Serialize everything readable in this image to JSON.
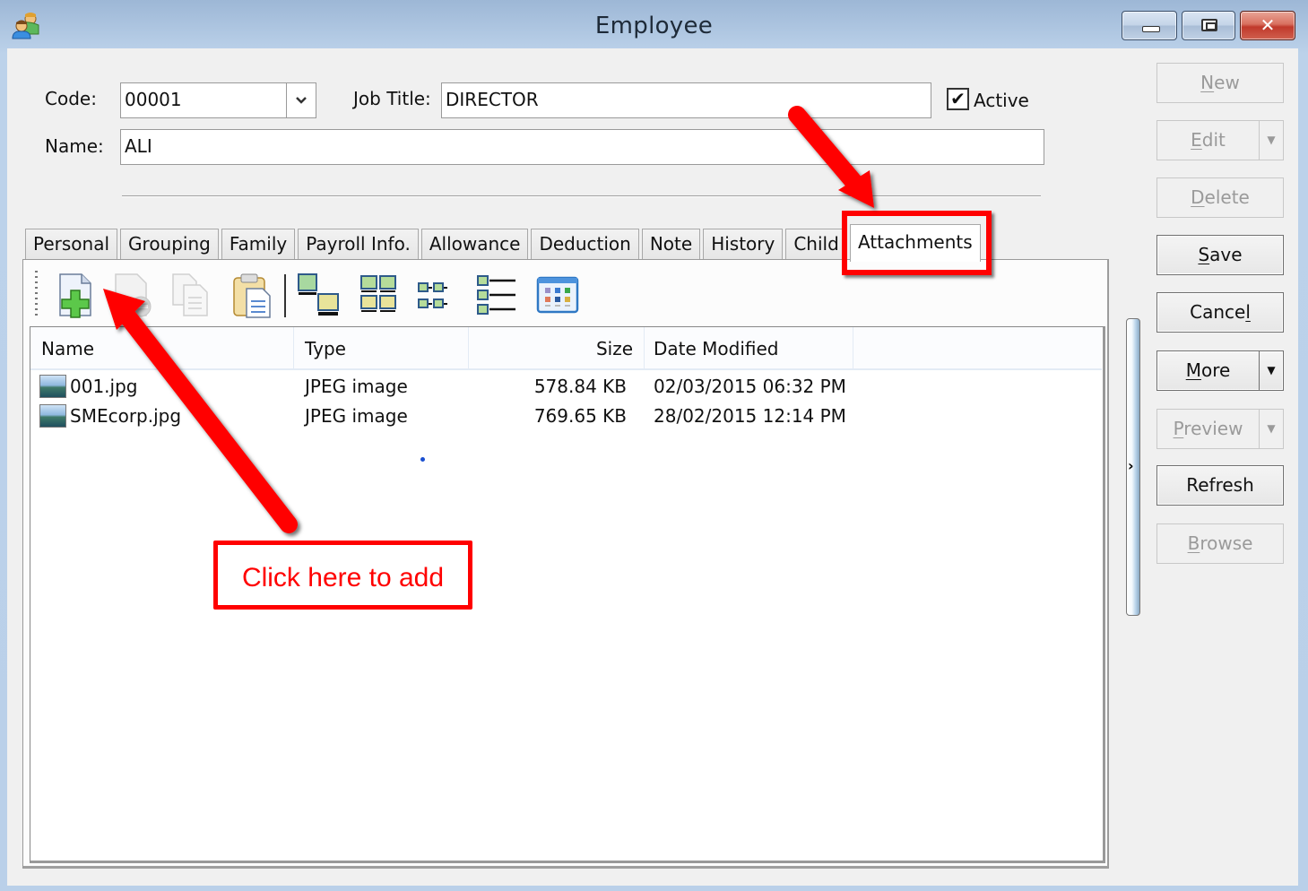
{
  "window": {
    "title": "Employee",
    "minimize_label": "",
    "close_label": "✕"
  },
  "form": {
    "code_label": "Code:",
    "code_value": "00001",
    "code_dropdown_glyph": "⌄",
    "job_title_label": "Job Title:",
    "job_title_value": "DIRECTOR",
    "active_label": "Active",
    "active_checked": true,
    "active_glyph": "✔",
    "name_label": "Name:",
    "name_value": "ALI"
  },
  "tabs": [
    {
      "label": "Personal"
    },
    {
      "label": "Grouping"
    },
    {
      "label": "Family"
    },
    {
      "label": "Payroll Info."
    },
    {
      "label": "Allowance"
    },
    {
      "label": "Deduction"
    },
    {
      "label": "Note"
    },
    {
      "label": "History"
    },
    {
      "label": "Child"
    },
    {
      "label": "Attachments",
      "active": true
    }
  ],
  "toolbar": {
    "items": [
      {
        "icon": "add-file-icon",
        "enabled": true
      },
      {
        "icon": "remove-file-icon",
        "enabled": false
      },
      {
        "icon": "copy-icon",
        "enabled": false
      },
      {
        "icon": "paste-icon",
        "enabled": true
      },
      {
        "icon": "view-large-icons-icon",
        "enabled": true
      },
      {
        "icon": "view-thumbnails-icon",
        "enabled": true
      },
      {
        "icon": "view-small-icons-icon",
        "enabled": true
      },
      {
        "icon": "view-list-icon",
        "enabled": true
      },
      {
        "icon": "view-details-icon",
        "enabled": true
      }
    ]
  },
  "attachments": {
    "columns": [
      "Name",
      "Type",
      "Size",
      "Date Modified"
    ],
    "rows": [
      {
        "name": "001.jpg",
        "type": "JPEG image",
        "size": "578.84 KB",
        "date_modified": "02/03/2015 06:32 PM"
      },
      {
        "name": "SMEcorp.jpg",
        "type": "JPEG image",
        "size": "769.65 KB",
        "date_modified": "28/02/2015 12:14 PM"
      }
    ]
  },
  "side_buttons": {
    "new": {
      "pre": "",
      "ul": "N",
      "post": "ew",
      "enabled": false
    },
    "edit": {
      "pre": "",
      "ul": "E",
      "post": "dit",
      "enabled": false
    },
    "delete": {
      "pre": "",
      "ul": "D",
      "post": "elete",
      "enabled": false
    },
    "save": {
      "pre": "",
      "ul": "S",
      "post": "ave",
      "enabled": true
    },
    "cancel": {
      "pre": "Cance",
      "ul": "l",
      "post": "",
      "enabled": true
    },
    "more": {
      "pre": "",
      "ul": "M",
      "post": "ore",
      "enabled": true
    },
    "preview": {
      "pre": "",
      "ul": "P",
      "post": "review",
      "enabled": false
    },
    "refresh": {
      "pre": "Refresh",
      "ul": "",
      "post": "",
      "enabled": true
    },
    "browse": {
      "pre": "",
      "ul": "B",
      "post": "rowse",
      "enabled": false
    },
    "dropdown_glyph": "▼"
  },
  "splitter": {
    "glyph": "›"
  },
  "annotation": {
    "callout_text": "Click here to add",
    "color": "#ff0000"
  },
  "colors": {
    "title_bar": "#b9cfe8",
    "client_bg": "#f0f0f0",
    "annotation_red": "#ff0000",
    "close_button": "#c0392b"
  }
}
